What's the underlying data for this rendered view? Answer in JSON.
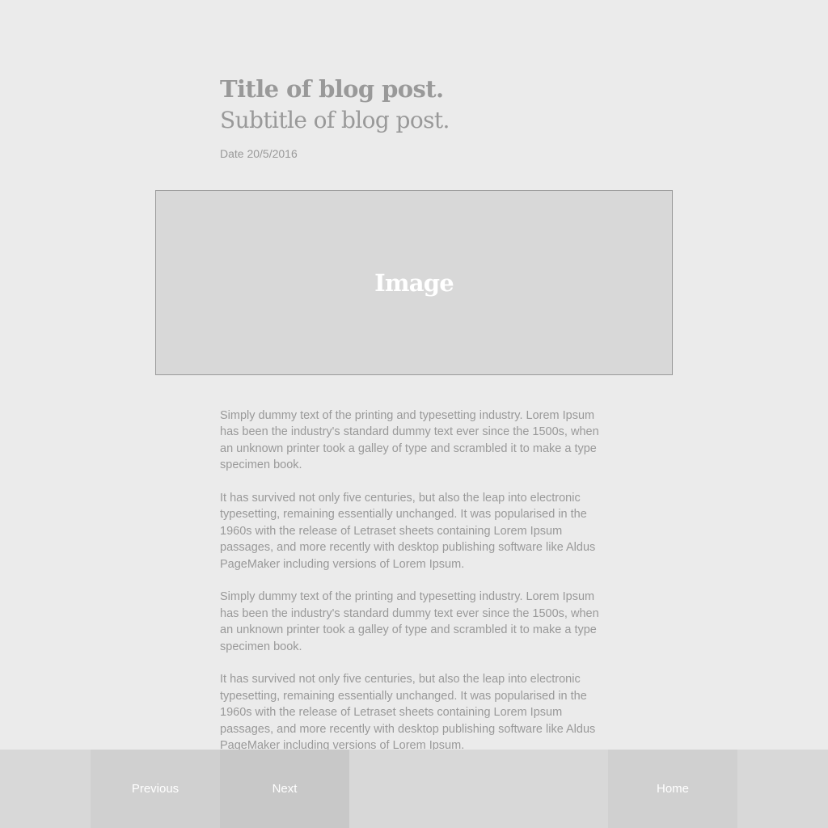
{
  "post": {
    "title": "Title of blog post.",
    "subtitle": "Subtitle of blog post.",
    "date": "Date 20/5/2016"
  },
  "image": {
    "label": "Image"
  },
  "body": {
    "paragraphs": [
      "Simply dummy text of the printing and typesetting industry. Lorem Ipsum has been the industry's standard dummy text ever since the 1500s, when an unknown printer took a galley of type and scrambled it to make a type specimen book.",
      "It has survived not only five centuries, but also the leap into electronic typesetting, remaining essentially unchanged. It was popularised in the 1960s with the release of Letraset sheets containing Lorem Ipsum passages, and more recently with desktop publishing software like Aldus PageMaker including versions of Lorem Ipsum.",
      "Simply dummy text of the printing and typesetting industry. Lorem Ipsum has been the industry's standard dummy text ever since the 1500s, when an unknown printer took a galley of type and scrambled it to make a type specimen book.",
      "It has survived not only five centuries, but also the leap into electronic typesetting, remaining essentially unchanged. It was popularised in the 1960s with the release of Letraset sheets containing Lorem Ipsum passages, and more recently with desktop publishing software like Aldus PageMaker including versions of Lorem Ipsum."
    ]
  },
  "nav": {
    "previous_label": "Previous",
    "next_label": "Next",
    "home_label": "Home"
  },
  "colors": {
    "background": "#ebebeb",
    "text": "#999999",
    "image_placeholder": "#d8d8d8",
    "nav_bar": "#d8d8d8"
  }
}
